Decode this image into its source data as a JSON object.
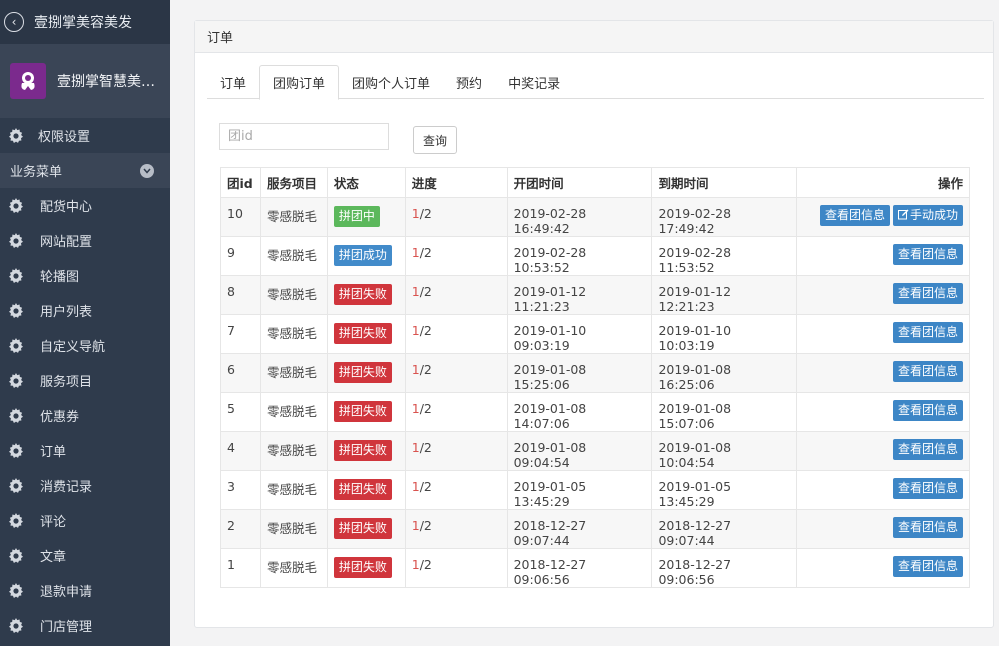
{
  "sidebar": {
    "app_title": "壹捌掌美容美发",
    "brand_name": "壹捌掌智慧美容美发",
    "top_items": [
      {
        "label": "权限设置",
        "icon": "gear-icon"
      }
    ],
    "section_label": "业务菜单",
    "items": [
      {
        "label": "配货中心"
      },
      {
        "label": "网站配置"
      },
      {
        "label": "轮播图"
      },
      {
        "label": "用户列表"
      },
      {
        "label": "自定义导航"
      },
      {
        "label": "服务项目"
      },
      {
        "label": "优惠券"
      },
      {
        "label": "订单"
      },
      {
        "label": "消费记录"
      },
      {
        "label": "评论"
      },
      {
        "label": "文章"
      },
      {
        "label": "退款申请"
      },
      {
        "label": "门店管理"
      }
    ]
  },
  "panel": {
    "title": "订单",
    "tabs": [
      {
        "label": "订单",
        "active": false
      },
      {
        "label": "团购订单",
        "active": true
      },
      {
        "label": "团购个人订单",
        "active": false
      },
      {
        "label": "预约",
        "active": false
      },
      {
        "label": "中奖记录",
        "active": false
      }
    ],
    "search_placeholder": "团id",
    "query_button": "查询"
  },
  "table": {
    "headers": [
      "团id",
      "服务项目",
      "状态",
      "进度",
      "开团时间",
      "到期时间",
      "操作"
    ],
    "view_button": "查看团信息",
    "manual_button": "手动成功",
    "rows": [
      {
        "id": "10",
        "service": "零感脱毛",
        "status": "拼团中",
        "status_color": "green",
        "progress_done": "1",
        "progress_total": "/2",
        "start": "2019-02-28 16:49:42",
        "end": "2019-02-28 17:49:42",
        "manual": true
      },
      {
        "id": "9",
        "service": "零感脱毛",
        "status": "拼团成功",
        "status_color": "blue",
        "progress_done": "1",
        "progress_total": "/2",
        "start": "2019-02-28 10:53:52",
        "end": "2019-02-28 11:53:52",
        "manual": false
      },
      {
        "id": "8",
        "service": "零感脱毛",
        "status": "拼团失败",
        "status_color": "red",
        "progress_done": "1",
        "progress_total": "/2",
        "start": "2019-01-12 11:21:23",
        "end": "2019-01-12 12:21:23",
        "manual": false
      },
      {
        "id": "7",
        "service": "零感脱毛",
        "status": "拼团失败",
        "status_color": "red",
        "progress_done": "1",
        "progress_total": "/2",
        "start": "2019-01-10 09:03:19",
        "end": "2019-01-10 10:03:19",
        "manual": false
      },
      {
        "id": "6",
        "service": "零感脱毛",
        "status": "拼团失败",
        "status_color": "red",
        "progress_done": "1",
        "progress_total": "/2",
        "start": "2019-01-08 15:25:06",
        "end": "2019-01-08 16:25:06",
        "manual": false
      },
      {
        "id": "5",
        "service": "零感脱毛",
        "status": "拼团失败",
        "status_color": "red",
        "progress_done": "1",
        "progress_total": "/2",
        "start": "2019-01-08 14:07:06",
        "end": "2019-01-08 15:07:06",
        "manual": false
      },
      {
        "id": "4",
        "service": "零感脱毛",
        "status": "拼团失败",
        "status_color": "red",
        "progress_done": "1",
        "progress_total": "/2",
        "start": "2019-01-08 09:04:54",
        "end": "2019-01-08 10:04:54",
        "manual": false
      },
      {
        "id": "3",
        "service": "零感脱毛",
        "status": "拼团失败",
        "status_color": "red",
        "progress_done": "1",
        "progress_total": "/2",
        "start": "2019-01-05 13:45:29",
        "end": "2019-01-05 13:45:29",
        "manual": false
      },
      {
        "id": "2",
        "service": "零感脱毛",
        "status": "拼团失败",
        "status_color": "red",
        "progress_done": "1",
        "progress_total": "/2",
        "start": "2018-12-27 09:07:44",
        "end": "2018-12-27 09:07:44",
        "manual": false
      },
      {
        "id": "1",
        "service": "零感脱毛",
        "status": "拼团失败",
        "status_color": "red",
        "progress_done": "1",
        "progress_total": "/2",
        "start": "2018-12-27 09:06:56",
        "end": "2018-12-27 09:06:56",
        "manual": false
      }
    ]
  },
  "colors": {
    "sidebar_bg": "#2f3b4c",
    "accent_blue": "#3d86c6",
    "success_green": "#5cb85c",
    "danger_red": "#d0353c"
  }
}
